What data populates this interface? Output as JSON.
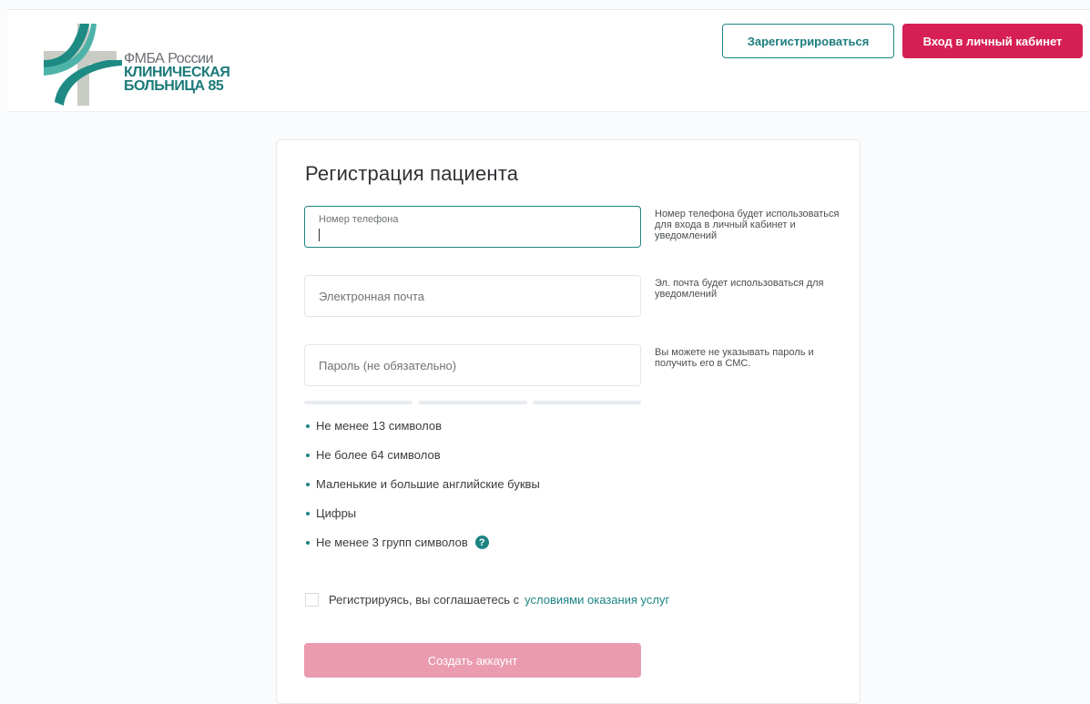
{
  "header": {
    "logo": {
      "line1": "ФМБА России",
      "line2": "КЛИНИЧЕСКАЯ",
      "line3": "БОЛЬНИЦА 85"
    },
    "register_label": "Зарегистрироваться",
    "login_label": "Вход в личный кабинет"
  },
  "form": {
    "title": "Регистрация пациента",
    "phone": {
      "label": "Номер телефона",
      "value": "",
      "hint": "Номер телефона будет использоваться для входа в личный кабинет и уведомлений"
    },
    "email": {
      "placeholder": "Электронная почта",
      "hint": "Эл. почта будет использоваться для уведомлений"
    },
    "password": {
      "placeholder": "Пароль (не обязательно)",
      "hint": "Вы можете не указывать пароль и получить его в СМС."
    },
    "requirements": [
      "Не менее 13 символов",
      "Не более 64 символов",
      "Маленькие и большие английские буквы",
      "Цифры",
      "Не менее 3 групп символов"
    ],
    "help_icon_glyph": "?",
    "agreement_text": "Регистрируясь, вы соглашаетесь с",
    "agreement_link": "условиями оказания услуг",
    "agreement_checked": false,
    "submit_label": "Создать аккаунт"
  },
  "colors": {
    "accent": "#1d8484",
    "brand_red": "#d61f55",
    "submit_disabled": "#ea9bb0"
  }
}
